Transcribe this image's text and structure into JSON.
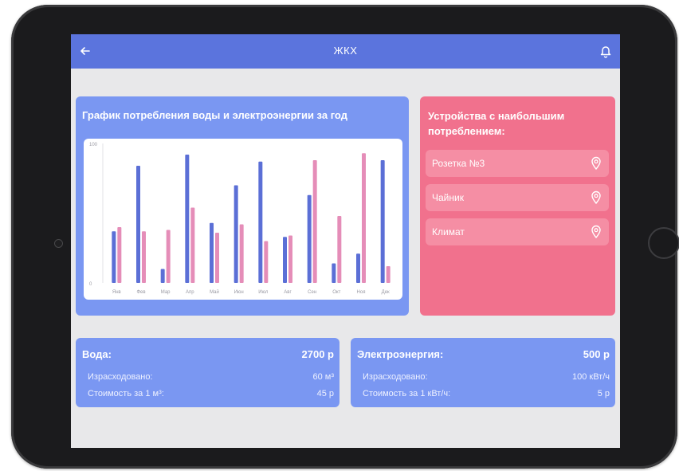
{
  "app": {
    "title": "ЖКХ"
  },
  "chart_card": {
    "title": "График потребления воды и электроэнергии за год"
  },
  "chart_data": {
    "type": "bar",
    "title": "График потребления воды и электроэнергии за год",
    "categories": [
      "Янв",
      "Фев",
      "Мар",
      "Апр",
      "Май",
      "Июн",
      "Июл",
      "Авг",
      "Сен",
      "Окт",
      "Ноя",
      "Дек"
    ],
    "y_ticks": [
      "100",
      "0"
    ],
    "ylim": [
      0,
      100
    ],
    "series": [
      {
        "color": "#5b6fd6",
        "values": [
          37,
          84,
          10,
          92,
          43,
          70,
          87,
          33,
          63,
          14,
          21,
          88
        ]
      },
      {
        "color": "#e58db8",
        "values": [
          40,
          37,
          38,
          54,
          36,
          42,
          30,
          34,
          88,
          48,
          93,
          12
        ]
      }
    ],
    "grid": false,
    "legend": "none"
  },
  "devices_card": {
    "title": "Устройства с наибольшим потреблением:",
    "items": [
      {
        "label": "Розетка №3",
        "icon": "location-pin-icon"
      },
      {
        "label": "Чайник",
        "icon": "location-pin-icon"
      },
      {
        "label": "Климат",
        "icon": "location-pin-icon"
      }
    ]
  },
  "water": {
    "title": "Вода:",
    "total": "2700 р",
    "used_label": "Израсходовано:",
    "used_value": "60 м³",
    "price_label": "Стоимость за 1 м³:",
    "price_value": "45 р"
  },
  "electricity": {
    "title": "Электроэнергия:",
    "total": "500 р",
    "used_label": "Израсходовано:",
    "used_value": "100 кВт/ч",
    "price_label": "Стоимость за 1 кВт/ч:",
    "price_value": "5 р"
  },
  "colors": {
    "app_bar": "#5b74dd",
    "card_blue": "#7a97f2",
    "card_pink": "#f1718d",
    "device_item": "#f58ea4",
    "water_bar": "#5b6fd6",
    "electric_bar": "#e58db8"
  }
}
